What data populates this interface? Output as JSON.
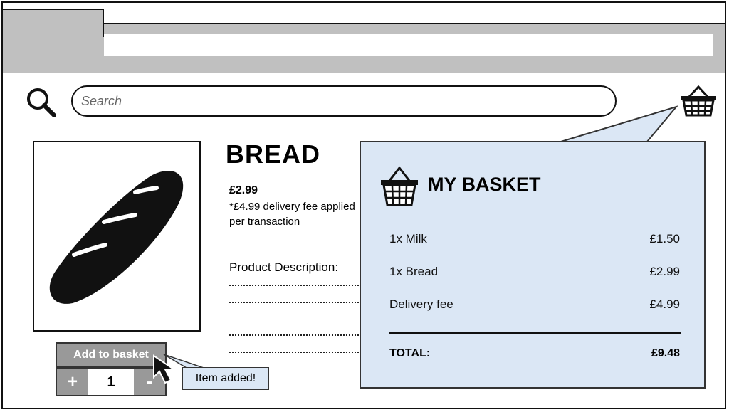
{
  "search": {
    "placeholder": "Search"
  },
  "product": {
    "title": "BREAD",
    "price": "£2.99",
    "fee_note": "*£4.99 delivery fee applied per transaction",
    "description_label": "Product Description:",
    "add_to_basket_label": "Add to basket",
    "quantity": "1",
    "increment_label": "+",
    "decrement_label": "-"
  },
  "toast": {
    "text": "Item added!"
  },
  "basket": {
    "title": "MY BASKET",
    "items": [
      {
        "label": "1x Milk",
        "price": "£1.50"
      },
      {
        "label": "1x Bread",
        "price": "£2.99"
      },
      {
        "label": "Delivery fee",
        "price": "£4.99"
      }
    ],
    "total_label": "TOTAL:",
    "total_value": "£9.48"
  },
  "colors": {
    "panel_bg": "#dbe7f5",
    "button_bg": "#999999",
    "chrome_bg": "#c0c0c0"
  },
  "icons": [
    "search-icon",
    "basket-icon",
    "bread-icon",
    "cursor-icon"
  ]
}
